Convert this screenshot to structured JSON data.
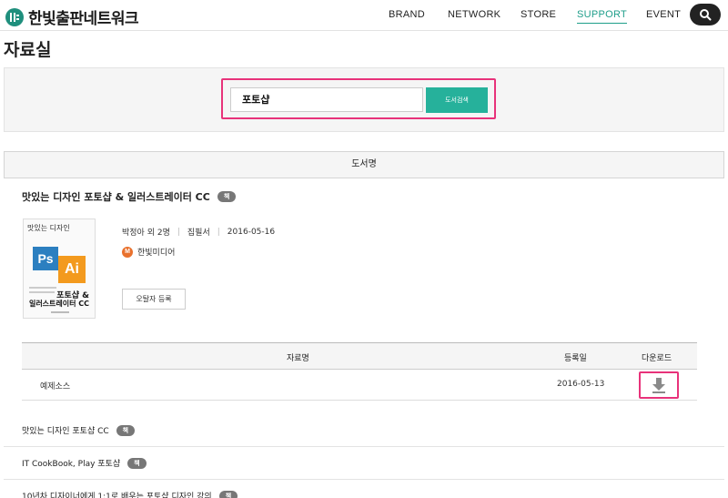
{
  "header": {
    "logo_text": "한빛출판네트워크",
    "nav": [
      {
        "label": "BRAND",
        "active": false
      },
      {
        "label": "NETWORK",
        "active": false
      },
      {
        "label": "STORE",
        "active": false
      },
      {
        "label": "SUPPORT",
        "active": true
      },
      {
        "label": "EVENT",
        "active": false
      }
    ],
    "search_icon": "search-icon"
  },
  "page_title": "자료실",
  "search": {
    "value": "포토샵",
    "button_label": "도서검색"
  },
  "result_header": "도서명",
  "book": {
    "title": "맛있는 디자인 포토샵 & 일러스트레이터 CC",
    "badge": "책",
    "cover": {
      "top_text": "맛있는 디자인",
      "ps": "Ps",
      "ai": "Ai",
      "line1": "포토샵 &",
      "line2": "일러스트레이터 CC"
    },
    "authors": "박정아 외 2명",
    "role": "집필서",
    "date": "2016-05-16",
    "publisher_initial": "M",
    "publisher": "한빛미디어",
    "errata_button": "오탈자 등록"
  },
  "table": {
    "headers": {
      "name": "자료명",
      "date": "등록일",
      "download": "다운로드"
    },
    "rows": [
      {
        "name": "예제소스",
        "date": "2016-05-13",
        "download_icon": "download-icon"
      }
    ]
  },
  "other_results": [
    {
      "title": "맛있는 디자인 포토샵 CC",
      "badge": "책"
    },
    {
      "title": "IT CookBook, Play 포토샵",
      "badge": "책"
    },
    {
      "title": "10년차 디자이너에게 1:1로 배우는 포토샵 디자인 강의",
      "badge": "책"
    }
  ],
  "colors": {
    "accent": "#26b19b",
    "highlight": "#e8327a",
    "logo": "#1f8f7d"
  }
}
